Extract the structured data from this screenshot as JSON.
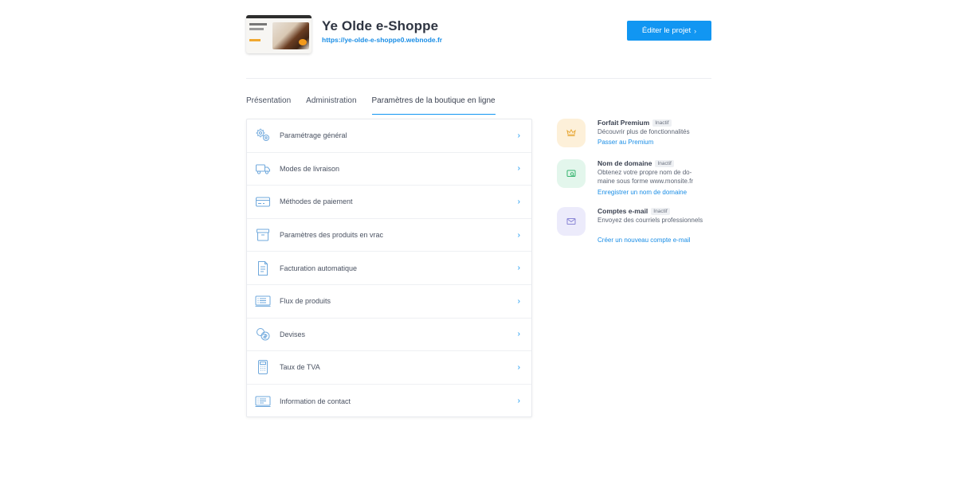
{
  "header": {
    "site_title": "Ye Olde e-Shoppe",
    "site_url": "https://ye-olde-e-shoppe0.webnode.fr",
    "edit_button": "Éditer le projet",
    "edit_chevron": "›"
  },
  "tabs": [
    {
      "label": "Présentation",
      "active": false
    },
    {
      "label": "Administration",
      "active": false
    },
    {
      "label": "Paramètres de la boutique en ligne",
      "active": true
    }
  ],
  "settings": [
    {
      "label": "Paramétrage général",
      "icon": "gears-icon"
    },
    {
      "label": "Modes de livraison",
      "icon": "truck-icon"
    },
    {
      "label": "Méthodes de paiement",
      "icon": "credit-card-icon"
    },
    {
      "label": "Paramètres des produits en vrac",
      "icon": "bulk-box-icon"
    },
    {
      "label": "Facturation automatique",
      "icon": "invoice-icon"
    },
    {
      "label": "Flux de produits",
      "icon": "feed-list-icon"
    },
    {
      "label": "Devises",
      "icon": "currency-coins-icon"
    },
    {
      "label": "Taux de TVA",
      "icon": "calculator-icon"
    },
    {
      "label": "Information de contact",
      "icon": "contact-card-icon"
    }
  ],
  "row_chevron": "›",
  "features": [
    {
      "title": "Forfait Premium",
      "badge": "Inactif",
      "desc": "Découvrir plus de fonctionnalités",
      "link": "Passer au Premium",
      "icon": "crown-icon",
      "icon_bg": "#fdf0d9",
      "icon_color": "#e8a93a"
    },
    {
      "title": "Nom de domaine",
      "badge": "Inactif",
      "desc": "Obtenez votre propre nom de do-maine sous forme www.monsite.fr",
      "link": "Enregistrer un nom de domaine",
      "icon": "domain-search-icon",
      "icon_bg": "#e3f6ec",
      "icon_color": "#35b46e"
    },
    {
      "title": "Comptes e-mail",
      "badge": "Inactif",
      "desc": "Envoyez des courriels professionnels",
      "link": "Créer un nouveau compte e-mail",
      "icon": "envelope-icon",
      "icon_bg": "#ecebfb",
      "icon_color": "#8a86d6"
    }
  ]
}
